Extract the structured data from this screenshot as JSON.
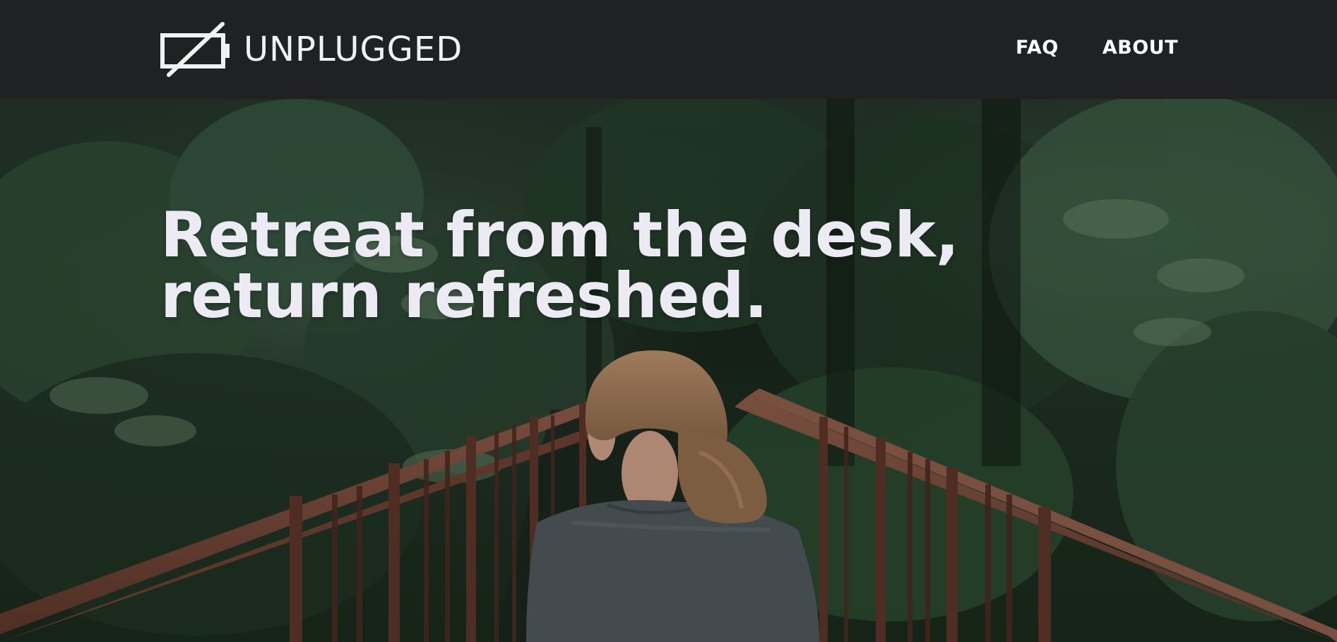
{
  "header": {
    "brand_name": "UNPLUGGED",
    "logo_icon": "unplugged-battery-icon",
    "nav": [
      {
        "label": "FAQ"
      },
      {
        "label": "ABOUT"
      }
    ]
  },
  "hero": {
    "heading_line1": "Retreat from the desk,",
    "heading_line2": "return refreshed.",
    "background": "forest-bridge-photo"
  },
  "colors": {
    "header_bg": "#1f2122",
    "text_light": "#ecebf4",
    "foliage_dark": "#1c2a1e",
    "bridge_rail": "#7a4a3a"
  }
}
